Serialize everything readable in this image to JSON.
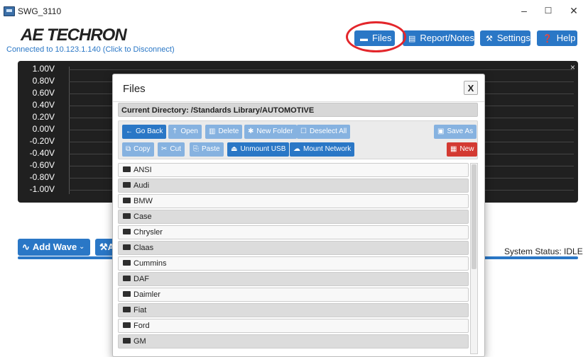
{
  "window": {
    "title": "SWG_3110",
    "minimize": "–",
    "maximize": "☐",
    "close": "✕"
  },
  "header": {
    "logo": "AE TECHRON",
    "connection": "Connected to 10.123.1.140 (Click to Disconnect)",
    "buttons": [
      {
        "label": "Files",
        "icon": "drive-icon"
      },
      {
        "label": "Report/Notes",
        "icon": "clipboard-icon"
      },
      {
        "label": "Settings",
        "icon": "wrench-icon"
      },
      {
        "label": "Help",
        "icon": "question-icon"
      }
    ]
  },
  "plot": {
    "y_labels": [
      "1.00V",
      "0.80V",
      "0.60V",
      "0.40V",
      "0.20V",
      "0.00V",
      "-0.20V",
      "-0.40V",
      "-0.60V",
      "-0.80V",
      "-1.00V"
    ],
    "close": "×"
  },
  "controls": {
    "add_wave": "Add Wave",
    "second_button": "A",
    "status": "System Status: IDLE"
  },
  "modal": {
    "title": "Files",
    "close": "X",
    "current_directory": "Current Directory: /Standards Library/AUTOMOTIVE",
    "toolbar_row1": [
      {
        "label": "Go Back",
        "icon": "arrow-left-icon",
        "state": "active"
      },
      {
        "label": "Open",
        "icon": "upload-icon",
        "state": "disabled"
      },
      {
        "label": "Delete",
        "icon": "trash-icon",
        "state": "disabled"
      },
      {
        "label": "New Folder",
        "icon": "gear-icon",
        "state": "disabled"
      },
      {
        "label": "Deselect All",
        "icon": "square-icon",
        "state": "disabled"
      },
      {
        "label": "Save As",
        "icon": "save-icon",
        "state": "disabled"
      }
    ],
    "toolbar_row2": [
      {
        "label": "Copy",
        "icon": "copy-icon",
        "state": "disabled"
      },
      {
        "label": "Cut",
        "icon": "cut-icon",
        "state": "disabled"
      },
      {
        "label": "Paste",
        "icon": "paste-icon",
        "state": "disabled"
      },
      {
        "label": "Unmount USB",
        "icon": "eject-icon",
        "state": "active"
      },
      {
        "label": "Mount Network",
        "icon": "cloud-icon",
        "state": "active"
      },
      {
        "label": "New",
        "icon": "calendar-icon",
        "state": "danger"
      }
    ],
    "folders": [
      "ANSI",
      "Audi",
      "BMW",
      "Case",
      "Chrysler",
      "Claas",
      "Cummins",
      "DAF",
      "Daimler",
      "Fiat",
      "Ford",
      "GM"
    ]
  },
  "colors": {
    "accent": "#2a77c6",
    "highlight": "#e3262b",
    "danger": "#d33a32",
    "plot_bg": "#202020"
  }
}
